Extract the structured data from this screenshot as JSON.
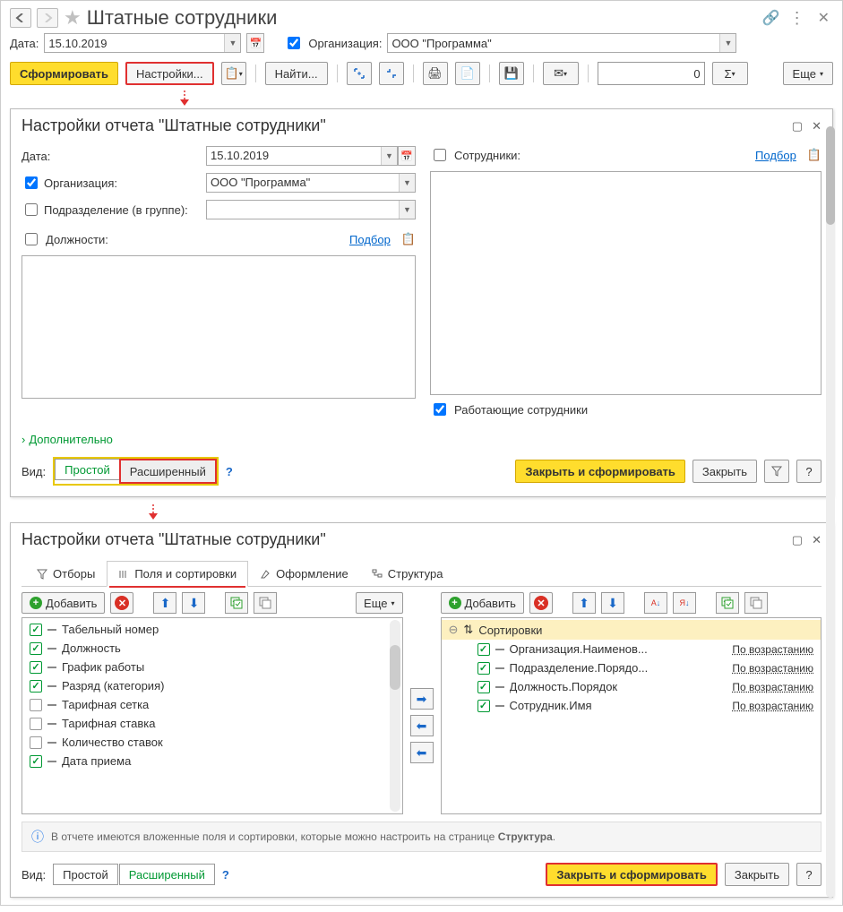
{
  "header": {
    "title": "Штатные сотрудники"
  },
  "filters": {
    "date_label": "Дата:",
    "date_value": "15.10.2019",
    "org_label": "Организация:",
    "org_value": "ООО \"Программа\""
  },
  "toolbar": {
    "form_btn": "Сформировать",
    "settings_btn": "Настройки...",
    "find_btn": "Найти...",
    "number_value": "0",
    "more_btn": "Еще"
  },
  "panel1": {
    "title": "Настройки отчета \"Штатные сотрудники\"",
    "date_label": "Дата:",
    "date_value": "15.10.2019",
    "org_label": "Организация:",
    "org_value": "ООО \"Программа\"",
    "dept_label": "Подразделение (в группе):",
    "positions_label": "Должности:",
    "select_link": "Подбор",
    "employees_label": "Сотрудники:",
    "working_label": "Работающие сотрудники",
    "more_link": "Дополнительно",
    "view_label": "Вид:",
    "view_simple": "Простой",
    "view_ext": "Расширенный",
    "close_form_btn": "Закрыть и сформировать",
    "close_btn": "Закрыть"
  },
  "panel2": {
    "title": "Настройки отчета \"Штатные сотрудники\"",
    "tabs": {
      "filters": "Отборы",
      "fields": "Поля и сортировки",
      "format": "Оформление",
      "structure": "Структура"
    },
    "add_btn": "Добавить",
    "more_btn": "Еще",
    "fields": [
      {
        "checked": true,
        "label": "Табельный номер"
      },
      {
        "checked": true,
        "label": "Должность"
      },
      {
        "checked": true,
        "label": "График работы"
      },
      {
        "checked": true,
        "label": "Разряд (категория)"
      },
      {
        "checked": false,
        "label": "Тарифная сетка"
      },
      {
        "checked": false,
        "label": "Тарифная ставка"
      },
      {
        "checked": false,
        "label": "Количество ставок"
      },
      {
        "checked": true,
        "label": "Дата приема"
      }
    ],
    "sort_header": "Сортировки",
    "sorts": [
      {
        "label": "Организация.Наименов...",
        "dir": "По возрастанию"
      },
      {
        "label": "Подразделение.Порядо...",
        "dir": "По возрастанию"
      },
      {
        "label": "Должность.Порядок",
        "dir": "По возрастанию"
      },
      {
        "label": "Сотрудник.Имя",
        "dir": "По возрастанию"
      }
    ],
    "info_text_1": "В отчете имеются вложенные поля и сортировки, которые можно настроить на странице ",
    "info_text_2": "Структура",
    "view_label": "Вид:",
    "view_simple": "Простой",
    "view_ext": "Расширенный",
    "close_form_btn": "Закрыть и сформировать",
    "close_btn": "Закрыть"
  }
}
